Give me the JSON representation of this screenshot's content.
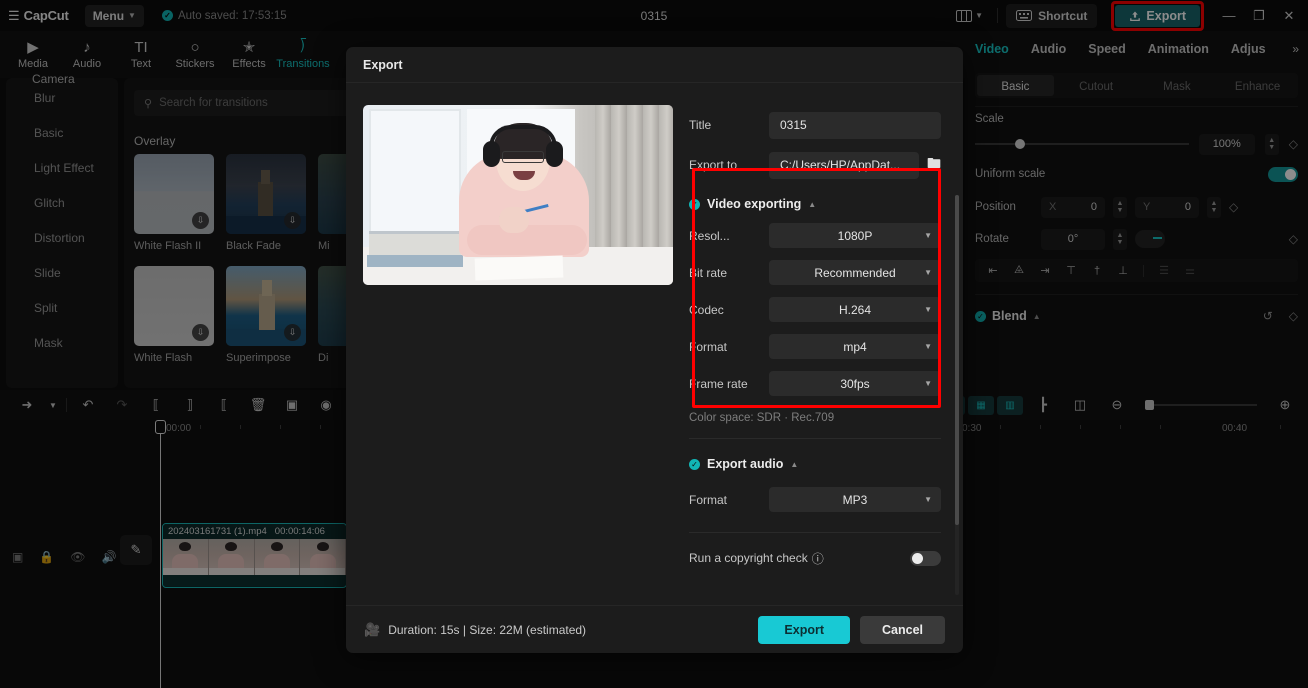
{
  "app": {
    "logo": "CapCut",
    "menu_label": "Menu",
    "autosave": "Auto saved: 17:53:15",
    "project_title": "0315"
  },
  "topbar": {
    "layout_icon": "layout-icon",
    "shortcut_label": "Shortcut",
    "shortcut_icon": "keyboard-icon",
    "export_label": "Export",
    "export_icon": "upload-icon",
    "minimize": "—",
    "maximize": "❐",
    "close": "✕"
  },
  "panel_tabs": [
    {
      "label": "Media",
      "icon": "media-icon",
      "active": false
    },
    {
      "label": "Audio",
      "icon": "audio-icon",
      "active": false
    },
    {
      "label": "Text",
      "icon": "text-icon",
      "active": false
    },
    {
      "label": "Stickers",
      "icon": "sticker-icon",
      "active": false
    },
    {
      "label": "Effects",
      "icon": "effects-icon",
      "active": false
    },
    {
      "label": "Transitions",
      "icon": "transitions-icon",
      "active": true
    }
  ],
  "left_categories": {
    "camera_label": "Camera",
    "items": [
      "Blur",
      "Basic",
      "Light Effect",
      "Glitch",
      "Distortion",
      "Slide",
      "Split",
      "Mask"
    ]
  },
  "browser": {
    "search_placeholder": "Search for transitions",
    "search_icon": "search-icon",
    "section_title": "Overlay",
    "items_row1": [
      {
        "name": "White Flash II",
        "art": "th-whiteflash2"
      },
      {
        "name": "Black Fade",
        "art": "th-tower"
      },
      {
        "name": "Mi",
        "art": "th-mist"
      }
    ],
    "items_row2": [
      {
        "name": "White Flash",
        "art": "th-white"
      },
      {
        "name": "Superimpose",
        "art": "th-super"
      },
      {
        "name": "Di",
        "art": "th-dis"
      }
    ],
    "download_icon": "download-icon"
  },
  "timeline_toolbar": {
    "left_tools": [
      "cursor-icon",
      "chevron-down-icon",
      "undo-icon",
      "redo-icon",
      "split-left-icon",
      "split-icon",
      "split-right-icon",
      "delete-icon",
      "crop-icon",
      "mirror-icon"
    ],
    "right_tools": [
      "keyframe-in-icon",
      "keyframe-mid-icon",
      "keyframe-out-icon",
      "mixer-icon",
      "snapshot-icon",
      "zoom-out-icon"
    ],
    "zoom_in_icon": "zoom-in-icon"
  },
  "timeline": {
    "ruler_labels": [
      "00:00",
      "0:30",
      "00:40"
    ],
    "playhead_time": "00:00",
    "track_controls": [
      "preview-toggle-icon",
      "lock-icon",
      "eye-icon",
      "mute-icon"
    ],
    "edit_icon": "pencil-icon",
    "clip": {
      "name": "202403161731 (1).mp4",
      "duration": "00:00:14:06"
    }
  },
  "right_panel": {
    "tabs": [
      {
        "label": "Video",
        "active": true
      },
      {
        "label": "Audio",
        "active": false
      },
      {
        "label": "Speed",
        "active": false
      },
      {
        "label": "Animation",
        "active": false
      },
      {
        "label": "Adjus",
        "active": false
      }
    ],
    "more_icon": "chevron-right-double-icon",
    "segments": [
      {
        "label": "Basic",
        "active": true
      },
      {
        "label": "Cutout",
        "active": false
      },
      {
        "label": "Mask",
        "active": false
      },
      {
        "label": "Enhance",
        "active": false
      }
    ],
    "scale": {
      "label": "Scale",
      "value": "100%",
      "keyframe_icon": "diamond-icon"
    },
    "uniform_scale": {
      "label": "Uniform scale",
      "enabled": true
    },
    "position": {
      "label": "Position",
      "x_axis": "X",
      "x_value": "0",
      "y_axis": "Y",
      "y_value": "0",
      "keyframe_icon": "diamond-icon"
    },
    "rotate": {
      "label": "Rotate",
      "value": "0°",
      "keyframe_icon": "diamond-icon"
    },
    "align_buttons": [
      "align-left-icon",
      "align-center-h-icon",
      "align-right-icon",
      "align-top-icon",
      "align-middle-v-icon",
      "align-bottom-icon",
      "distribute-h-icon",
      "distribute-v-icon"
    ],
    "blend": {
      "label": "Blend",
      "enabled": true,
      "reset_icon": "reset-icon",
      "keyframe_icon": "diamond-icon"
    }
  },
  "export_dialog": {
    "title": "Export",
    "fields": {
      "title_label": "Title",
      "title_value": "0315",
      "export_to_label": "Export to",
      "export_to_value": "C:/Users/HP/AppDat...",
      "folder_icon": "folder-icon"
    },
    "video_section": {
      "heading": "Video exporting",
      "enabled": true,
      "collapse_icon": "caret-up-icon",
      "rows": [
        {
          "label": "Resol...",
          "value": "1080P"
        },
        {
          "label": "Bit rate",
          "value": "Recommended"
        },
        {
          "label": "Codec",
          "value": "H.264"
        },
        {
          "label": "Format",
          "value": "mp4"
        },
        {
          "label": "Frame rate",
          "value": "30fps"
        }
      ],
      "color_space": "Color space: SDR · Rec.709"
    },
    "audio_section": {
      "heading": "Export audio",
      "enabled": true,
      "collapse_icon": "caret-up-icon",
      "rows": [
        {
          "label": "Format",
          "value": "MP3"
        }
      ]
    },
    "copyright": {
      "label": "Run a copyright check",
      "info_icon": "info-icon",
      "enabled": false
    },
    "footer": {
      "film_icon": "film-icon",
      "duration_info": "Duration: 15s | Size: 22M (estimated)",
      "export_label": "Export",
      "cancel_label": "Cancel"
    }
  },
  "annotations": {
    "highlight_color": "#ff0000",
    "accent_color": "#18c6c6"
  }
}
